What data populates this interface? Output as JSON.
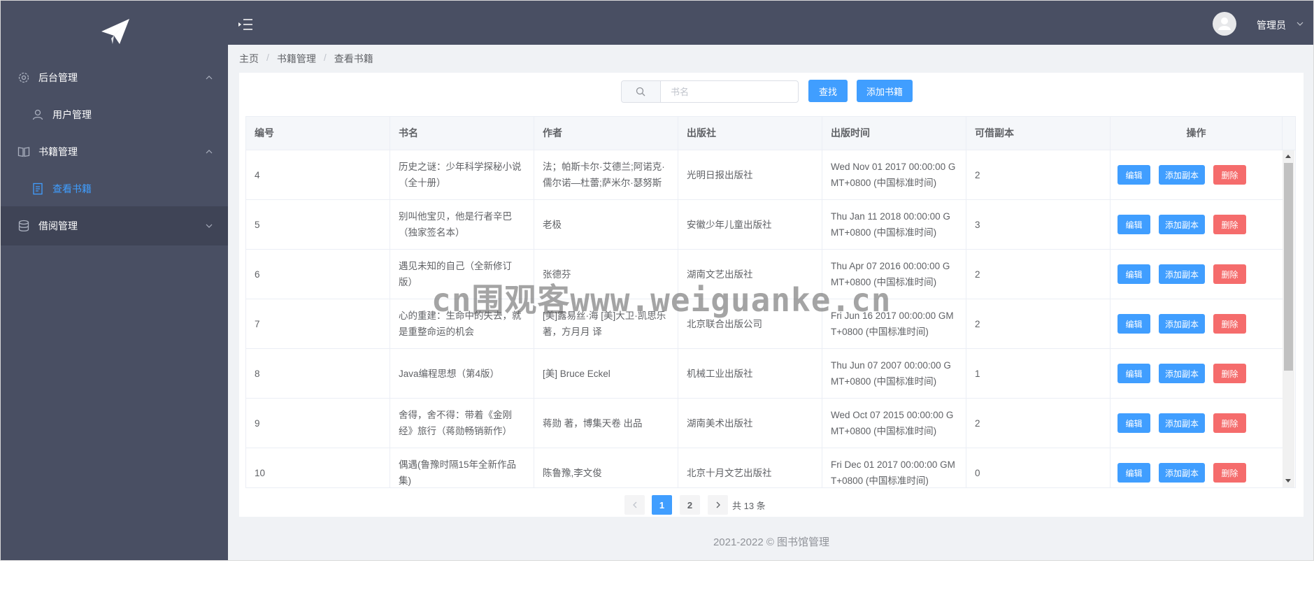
{
  "sidebar": {
    "logo_icon": "paper-plane-icon",
    "menus": [
      {
        "label": "后台管理",
        "icon": "gear-icon",
        "expanded": true,
        "children": [
          {
            "label": "用户管理",
            "icon": "user-icon"
          }
        ]
      },
      {
        "label": "书籍管理",
        "icon": "book-icon",
        "expanded": true,
        "children": [
          {
            "label": "查看书籍",
            "icon": "document-icon",
            "active": true
          }
        ]
      },
      {
        "label": "借阅管理",
        "icon": "database-icon",
        "expanded": false,
        "children": []
      }
    ]
  },
  "header": {
    "toggle_icon": "menu-fold-icon",
    "user": "管理员"
  },
  "breadcrumb": [
    "主页",
    "书籍管理",
    "查看书籍"
  ],
  "search": {
    "placeholder": "书名",
    "value": ""
  },
  "toolbar": {
    "search_label": "查找",
    "add_book_label": "添加书籍"
  },
  "table": {
    "columns": [
      "编号",
      "书名",
      "作者",
      "出版社",
      "出版时间",
      "可借副本",
      "操作"
    ],
    "action_labels": {
      "edit": "编辑",
      "add_copy": "添加副本",
      "delete": "删除"
    },
    "rows": [
      {
        "id": "4",
        "title": [
          "历史之谜：少年科学探秘小说",
          "（全十册）"
        ],
        "author": [
          "法；帕斯卡尔·艾德兰;阿诺克·",
          "儒尔诺—杜蕾;萨米尔·瑟努斯"
        ],
        "publisher": "光明日报出版社",
        "date": [
          "Wed Nov 01 2017 00:00:00 G",
          "MT+0800 (中国标准时间)"
        ],
        "copies": "2"
      },
      {
        "id": "5",
        "title": [
          "别叫他宝贝，他是行者辛巴",
          "（独家签名本）"
        ],
        "author": [
          "老极"
        ],
        "publisher": "安徽少年儿童出版社",
        "date": [
          "Thu Jan 11 2018 00:00:00 G",
          "MT+0800 (中国标准时间)"
        ],
        "copies": "3"
      },
      {
        "id": "6",
        "title": [
          "遇见未知的自己（全新修订",
          "版）"
        ],
        "author": [
          "张德芬"
        ],
        "publisher": "湖南文艺出版社",
        "date": [
          "Thu Apr 07 2016 00:00:00 G",
          "MT+0800 (中国标准时间)"
        ],
        "copies": "2"
      },
      {
        "id": "7",
        "title": [
          "心的重建：生命中的失去，就",
          "是重整命运的机会"
        ],
        "author": [
          "[美]露易丝·海 [美]大卫·凯思乐",
          "著，方月月 译"
        ],
        "publisher": "北京联合出版公司",
        "date": [
          "Fri Jun 16 2017 00:00:00 GM",
          "T+0800 (中国标准时间)"
        ],
        "copies": "2"
      },
      {
        "id": "8",
        "title": [
          "Java编程思想（第4版）"
        ],
        "author": [
          "[美] Bruce Eckel"
        ],
        "publisher": "机械工业出版社",
        "date": [
          "Thu Jun 07 2007 00:00:00 G",
          "MT+0800 (中国标准时间)"
        ],
        "copies": "1"
      },
      {
        "id": "9",
        "title": [
          "舍得，舍不得：带着《金刚",
          "经》旅行（蒋勋畅销新作）"
        ],
        "author": [
          "蒋勋 著，博集天卷 出品"
        ],
        "publisher": "湖南美术出版社",
        "date": [
          "Wed Oct 07 2015 00:00:00 G",
          "MT+0800 (中国标准时间)"
        ],
        "copies": "2"
      },
      {
        "id": "10",
        "title": [
          "偶遇(鲁豫时隔15年全新作品",
          "集)"
        ],
        "author": [
          "陈鲁豫,李文俊"
        ],
        "publisher": "北京十月文艺出版社",
        "date": [
          "Fri Dec 01 2017 00:00:00 GM",
          "T+0800 (中国标准时间)"
        ],
        "copies": "0"
      }
    ]
  },
  "pagination": {
    "pages": [
      "1",
      "2"
    ],
    "current": "1",
    "total_text": "共 13 条",
    "prev_icon": "chevron-left-icon",
    "next_icon": "chevron-right-icon"
  },
  "footer": "2021-2022 © 图书馆管理",
  "watermark": "cn围观客www.weiguanke.cn",
  "colors": {
    "sidebar_bg": "#494f63",
    "primary": "#409eff",
    "danger": "#f56c6c",
    "main_bg": "#f0f2f5"
  }
}
